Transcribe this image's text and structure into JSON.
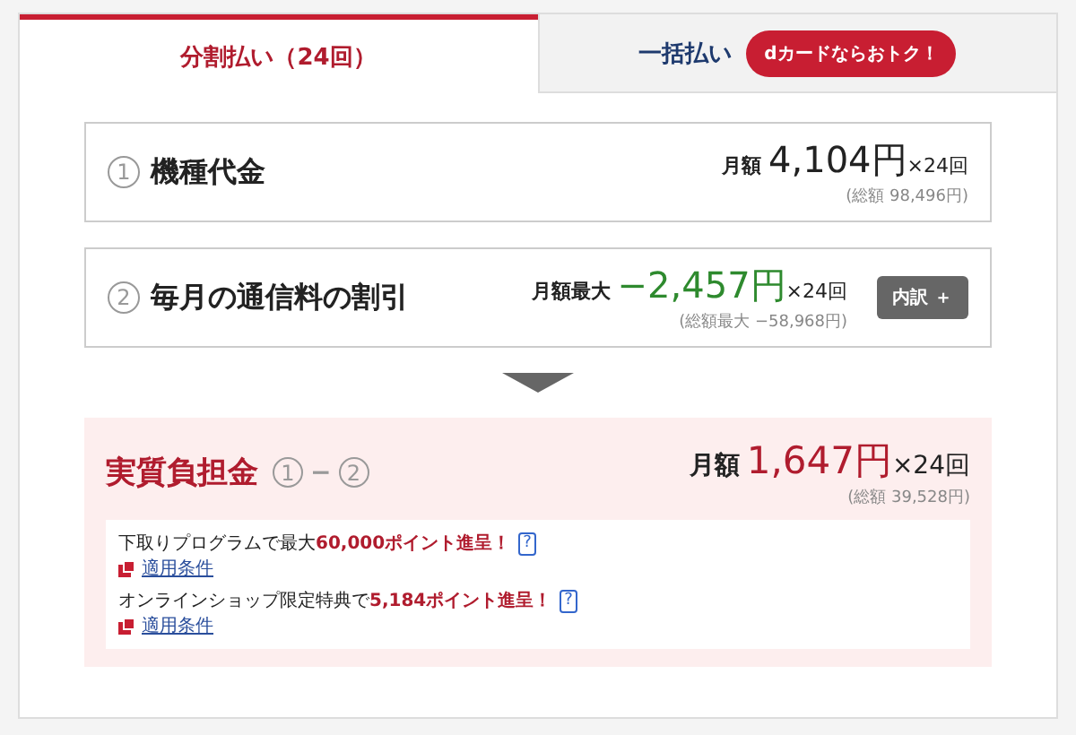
{
  "tabs": [
    {
      "label": "分割払い（24回）",
      "selected": true
    },
    {
      "label": "一括払い",
      "selected": false,
      "badge": "dカードならおトク！"
    }
  ],
  "items": [
    {
      "kind": "cost",
      "number": "1",
      "title": "機種代金",
      "amount_label": "月額",
      "amount": "4,104円",
      "times": "×24回",
      "total": "(総額 98,496円)"
    },
    {
      "kind": "discount",
      "number": "2",
      "title": "毎月の通信料の割引",
      "amount_label": "月額最大",
      "amount": "−2,457円",
      "times": "×24回",
      "total": "(総額最大 −58,968円)",
      "button": "内訳 ＋"
    }
  ],
  "result": {
    "title": "実質負担金",
    "formula": [
      "1",
      "−",
      "2"
    ],
    "amount_label": "月額",
    "amount": "1,647円",
    "times": "×24回",
    "total": "(総額 39,528円)",
    "offers": [
      {
        "text": "下取りプログラムで最大",
        "highlight": "60,000ポイント進呈！",
        "help": "?",
        "link": "適用条件"
      },
      {
        "text": "オンラインショップ限定特典で",
        "highlight": "5,184ポイント進呈！",
        "help": "?",
        "link": "適用条件"
      }
    ]
  }
}
